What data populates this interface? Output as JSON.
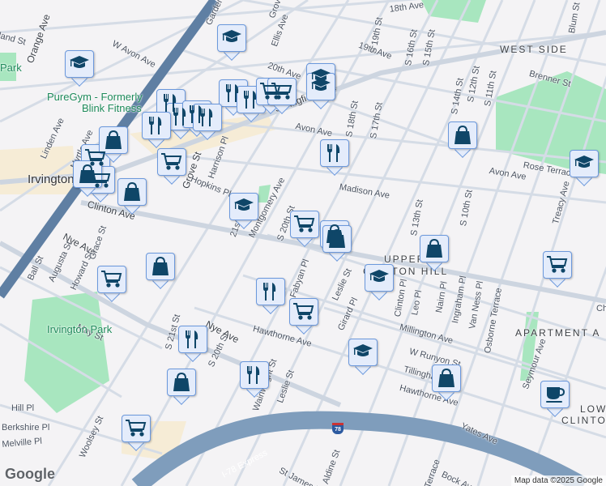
{
  "map": {
    "attribution": "Map data ©2025 Google",
    "logo": "Google",
    "highway_shield": "78",
    "colors": {
      "background": "#f4f3f5",
      "road": "#d5dce6",
      "highway": "#7f9dbc",
      "park": "#a8e6bf",
      "marker_fill": "#e4ecfb",
      "marker_border": "#6b98dc",
      "icon": "#0f4668"
    },
    "areas": [
      "WEST SIDE",
      "UPPER",
      "CLINTON HILL",
      "APARTMENT A",
      "LOWER",
      "CLINTON"
    ],
    "city": "Irvington",
    "pois": [
      "PureGym - Formerly",
      "Blink Fitness",
      "Irvington Park",
      "Park"
    ],
    "streets": [
      "18th Ave",
      "Orange Ave",
      "W Avon Ave",
      "Linden Ave",
      "Myrtle Ave",
      "Ellis Ave",
      "20th Ave",
      "19th Ave",
      "S 20th St",
      "S 19th St",
      "S 18th St",
      "S 17th St",
      "S 16th St",
      "S 15th St",
      "S 14th St",
      "S 12th St",
      "S 11th St",
      "S 10th St",
      "Brenner St",
      "Blum St",
      "Springfield Ave",
      "Avon Ave",
      "Harrison Pl",
      "Grove St",
      "Hopkins Pl",
      "Montgomery Ave",
      "21st St",
      "Madison Ave",
      "Rose Terrace",
      "Avon Ave",
      "Treacy Ave",
      "Clinton Ave",
      "Nye Ave",
      "Ball St",
      "Augusta St",
      "Howard St",
      "Grace St",
      "Fabyan Pl",
      "Leslie St",
      "Girard Pl",
      "Clinton Pl",
      "Leo Pl",
      "Nairn Pl",
      "Ingraham Pl",
      "Van Ness Pl",
      "Osborne Terrace",
      "Millington Ave",
      "W Runyon St",
      "Tillinghast St",
      "Hawthorne Ave",
      "Seymour Ave",
      "May St",
      "S 21st St",
      "S 20th St",
      "Hawthorne Ave",
      "Nye Ave",
      "Wainwright St",
      "Leslie St",
      "Yates Ave",
      "I-78 Express",
      "Berkshire Pl",
      "Melville Pl",
      "Woolsey St",
      "Aldine St",
      "St James Pl",
      "Bock Ave",
      "Terrace",
      "Hill Pl",
      "land St",
      "Garden State Pkwy",
      "Grove St",
      "S 13th St",
      "Ch"
    ]
  },
  "markers": [
    "education",
    "education",
    "education",
    "education",
    "education",
    "education",
    "education",
    "education",
    "restaurant",
    "restaurant",
    "restaurant",
    "restaurant",
    "restaurant",
    "restaurant",
    "restaurant",
    "restaurant",
    "restaurant",
    "restaurant",
    "restaurant",
    "grocery",
    "grocery",
    "grocery",
    "grocery",
    "grocery",
    "grocery",
    "grocery",
    "grocery",
    "grocery",
    "grocery",
    "shopping",
    "shopping",
    "shopping",
    "shopping",
    "shopping",
    "shopping",
    "shopping",
    "shopping",
    "shopping",
    "shopping",
    "cafe"
  ]
}
